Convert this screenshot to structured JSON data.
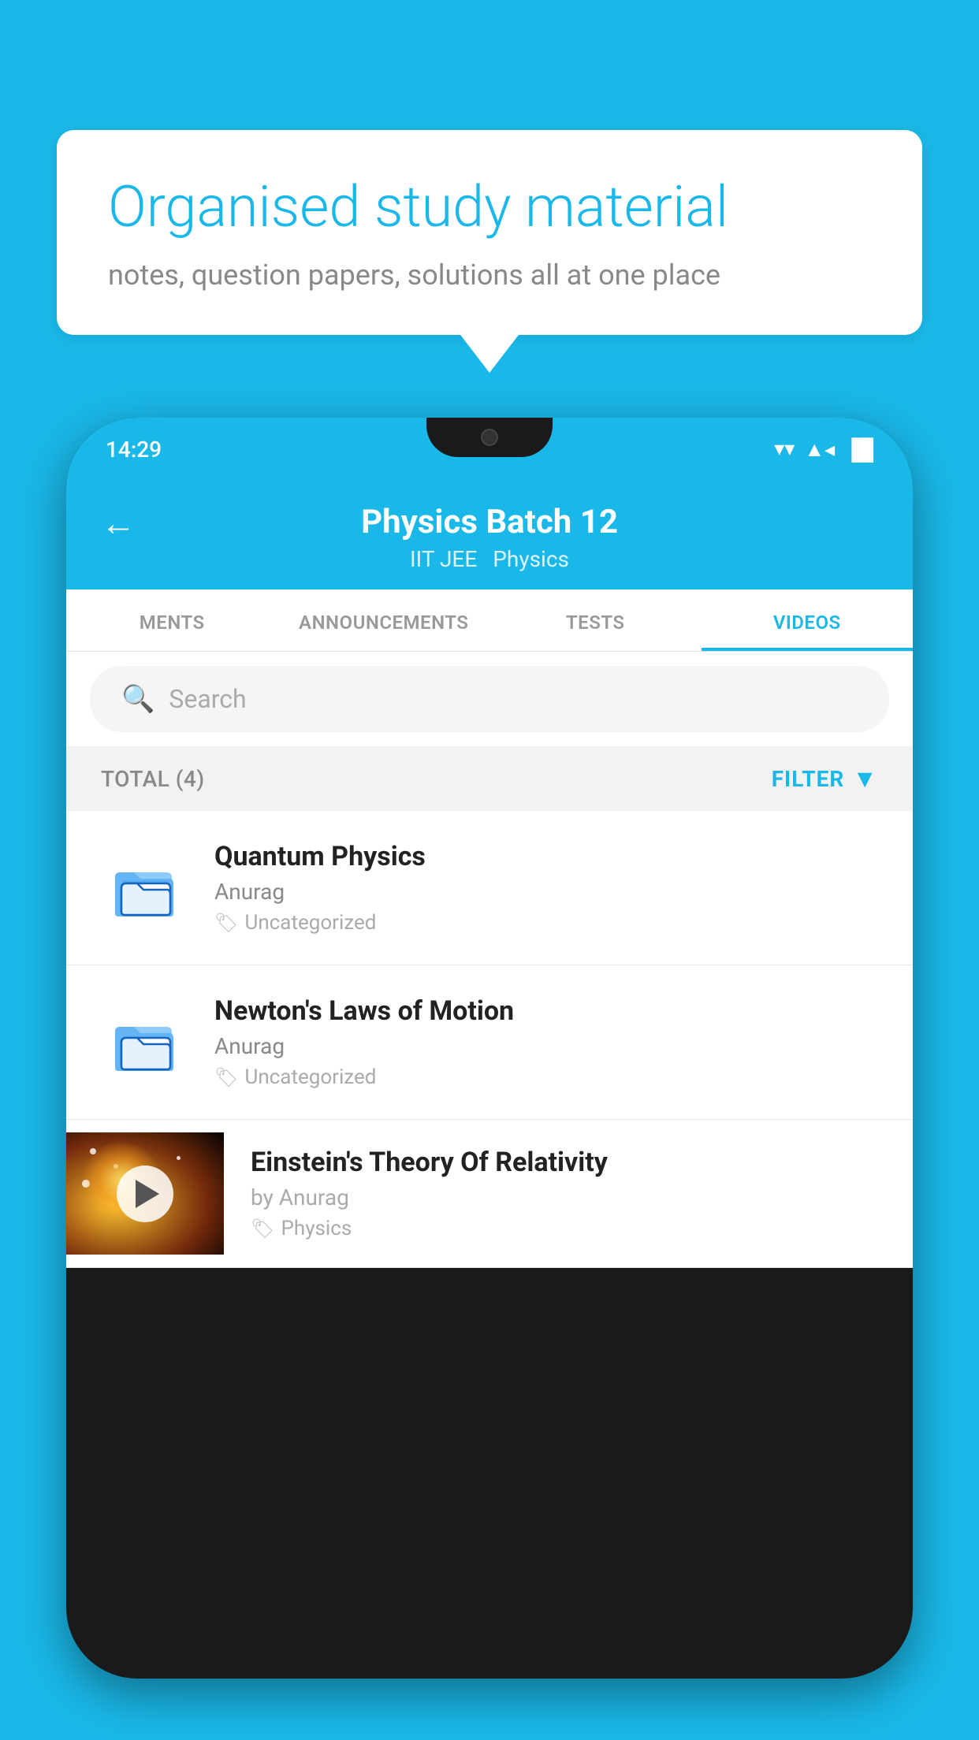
{
  "background_color": "#1ab8e8",
  "bubble": {
    "title": "Organised study material",
    "subtitle": "notes, question papers, solutions all at one place"
  },
  "status_bar": {
    "time": "14:29",
    "wifi": "▼",
    "signal": "▲",
    "battery": "▌"
  },
  "header": {
    "back_label": "←",
    "title": "Physics Batch 12",
    "tags": [
      "IIT JEE",
      "Physics"
    ]
  },
  "tabs": [
    {
      "label": "MENTS",
      "active": false
    },
    {
      "label": "ANNOUNCEMENTS",
      "active": false
    },
    {
      "label": "TESTS",
      "active": false
    },
    {
      "label": "VIDEOS",
      "active": true
    }
  ],
  "search": {
    "placeholder": "Search"
  },
  "filter": {
    "total_label": "TOTAL (4)",
    "button_label": "FILTER"
  },
  "videos": [
    {
      "title": "Quantum Physics",
      "author": "Anurag",
      "tag": "Uncategorized",
      "type": "folder"
    },
    {
      "title": "Newton's Laws of Motion",
      "author": "Anurag",
      "tag": "Uncategorized",
      "type": "folder"
    },
    {
      "title": "Einstein's Theory Of Relativity",
      "author": "by Anurag",
      "tag": "Physics",
      "type": "video"
    }
  ]
}
